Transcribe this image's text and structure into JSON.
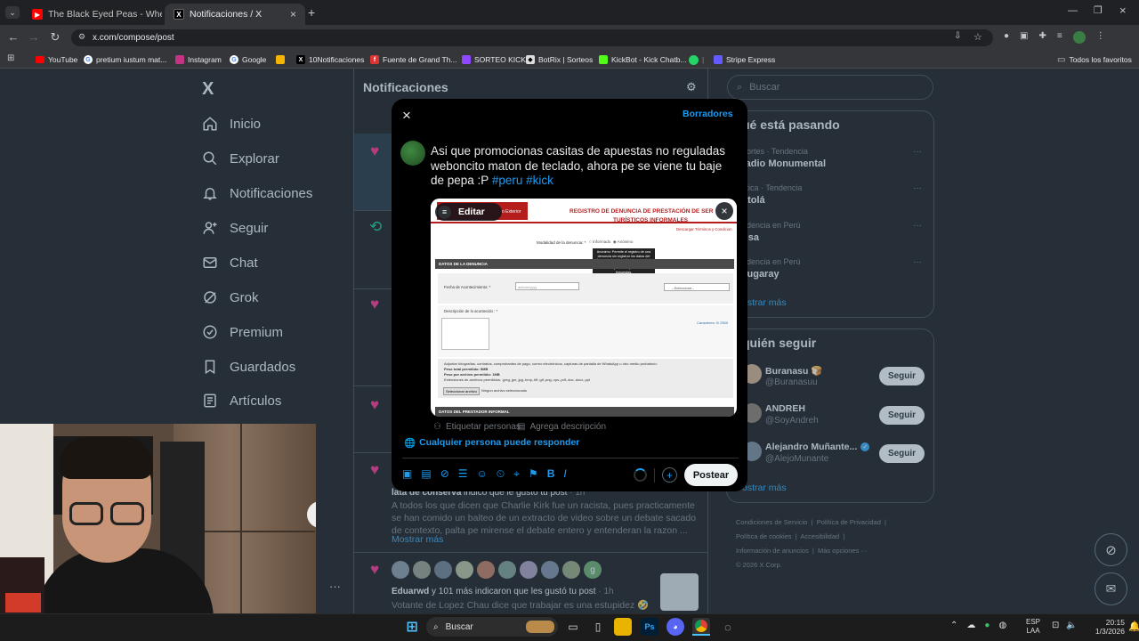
{
  "browser": {
    "tabs": [
      {
        "title": "The Black Eyed Peas - Whe",
        "active": false
      },
      {
        "title": "Notificaciones / X",
        "active": true
      }
    ],
    "url": "x.com/compose/post",
    "bookmarks": [
      "YouTube",
      "pretium iustum mat...",
      "Instagram",
      "Google",
      "10Notificaciones",
      "Fuente de Grand Th...",
      "SORTEO KICK",
      "BotRix | Sorteos",
      "KickBot - Kick Chatb...",
      "Stripe Express",
      "Todos los favoritos"
    ]
  },
  "x_sidebar": {
    "logo": "X",
    "items": [
      "Inicio",
      "Explorar",
      "Notificaciones",
      "Seguir",
      "Chat",
      "Grok",
      "Premium",
      "Guardados",
      "Artículos"
    ]
  },
  "notifications": {
    "header": "Notificaciones",
    "visible_entry": {
      "author_fragment": "lata de conserva",
      "action": " indicó que le gustó tu post",
      "age": " · 1h",
      "text": "A todos los que dicen que Charlie Kirk fue un racista, pues practicamente se han comido un balteo de un extracto de video sobre un debate sacado de contexto, palta pe mirense el debate entero y entenderan la razon ...",
      "more": "Mostrar más"
    },
    "last_entry": {
      "author": "Eduarwd",
      "action": " y 101 más indicaron que les gustó tu post",
      "age": " · 1h",
      "text": "Votante de Lopez Chau dice que trabajar es una estupidez 🤣",
      "avatar_letter": "g"
    }
  },
  "right_column": {
    "search_placeholder": "Buscar",
    "trends_title": "ué está pasando",
    "trends": [
      {
        "meta": "portes · Tendencia",
        "name": "tadio Monumental"
      },
      {
        "meta": "lítica · Tendencia",
        "name": "atolá"
      },
      {
        "meta": "ndencia en Perú",
        "name": "nsa"
      },
      {
        "meta": "ndencia en Perú",
        "name": "zugaray"
      }
    ],
    "show_more": "ostrar más",
    "who_title": "quién seguir",
    "follow": [
      {
        "name": "Buranasu 🍞",
        "handle": "@Buranasuu",
        "button": "Seguir"
      },
      {
        "name": "ANDREH",
        "handle": "@SoyAndreh",
        "button": "Seguir"
      },
      {
        "name": "Alejandro Muñante...",
        "handle": "@AlejoMunante",
        "button": "Seguir"
      }
    ],
    "show_more_2": "ostrar más",
    "footer": [
      "Condiciones de Servicio",
      "Política de Privacidad",
      "Política de cookies",
      "Accesibilidad",
      "Información de anuncios",
      "Más opciones ···",
      "© 2026 X Corp."
    ]
  },
  "compose": {
    "close": "×",
    "drafts": "Borradores",
    "text_plain": "Asi que promocionas casitas de apuestas no reguladas weboncito maton de teclado, ahora pe se viene tu baje de pepa :P ",
    "hashtags": [
      "#peru",
      "#kick"
    ],
    "media": {
      "edit_label": "Editar",
      "form_title_1": "REGISTRO DE DENUNCIA DE PRESTACIÓN DE SER",
      "form_title_2": "TURÍSTICOS INFORMALES",
      "form_link": "Descargar Términos y Condicion",
      "left_label": "o Exterior",
      "modalidad": "Modalidad de la denuncia: *",
      "informado": "Informado",
      "anonimo": "Anónimo",
      "tooltip": "Anónimo: Permite el registro de una denuncia sin registrar los datos del denunciante, sin embargo, no podrás conocer en detalle nuestro los acciones ejecutadas por siniestros impuestas.",
      "section_1": "DATOS DE LA DENUNCIA",
      "fecha_label": "Fecha de Acontecimiento: *",
      "fecha_placeholder": "dd/mm/yyyy",
      "seleccione": "--Seleccione--",
      "descripcion_label": "Descripción de lo acontecido : *",
      "caracteres": "Caracteres: 0/ 2500",
      "adjuntar": "Adjuntar fotografías, contratos, comprobantes de pago, correo electrónicos, capturas de pantalla de WhatsApp u otro medio probatorio:",
      "peso_total": "Peso total permitido: 5MB",
      "peso_archivo": "Peso por archivo permitido: 1MB",
      "extensiones": "Extensiones de archivos permitidos: .jpeg,.jpe,.jpg,.bmp,.tiff,.gif,.png,.xps,.pdf,.doc,.docx,.ppt",
      "seleccionar": "Seleccionar archivo",
      "ningun": "Ningún archivo seleccionado",
      "section_2": "DATOS DEL PRESTADOR INFORMAL"
    },
    "tag_people": "Etiquetar personas",
    "add_description": "Agrega descripción",
    "reply_setting": "Cualquier persona puede responder",
    "post_button": "Postear"
  },
  "taskbar": {
    "search": "Buscar",
    "lang_1": "ESP",
    "lang_2": "LAA",
    "time": "20:15",
    "date": "1/3/2026"
  },
  "colors": {
    "x_blue": "#1d9bf0",
    "like_pink": "#f91880",
    "repost_green": "#00ba7c"
  }
}
